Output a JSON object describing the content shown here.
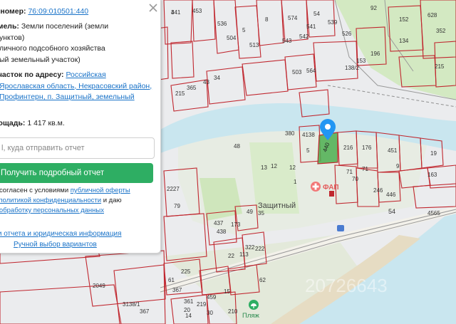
{
  "panel": {
    "cadastral_label": "й номер:",
    "cadastral_number": "76:09:010501:440",
    "category_label": "емель:",
    "category_lines": [
      "Земли поселений (земли",
      "унктов)",
      "личного подсобного хозяйства",
      "ый земельный участок)"
    ],
    "address_label": "участок по адресу:",
    "address_lines": [
      "Российская",
      "Ярославская область, Некрасовский район,",
      "Профинтерн, п. Защитный, земельный"
    ],
    "area_label": "лощадь:",
    "area_value": "1 417 кв.м.",
    "email_placeholder": "l, куда отправить отчет",
    "submit_button": "Получить подробный отчет",
    "consent_lines": [
      {
        "pre": "и согласен с условиями ",
        "link": "публичной оферты",
        "post": ""
      },
      {
        "pre": "с ",
        "link": "политикой конфиденциальности",
        "post": " и даю"
      },
      {
        "pre": "",
        "link": "а обработку персональных данных",
        "post": ""
      }
    ],
    "sample_link": "ли отчета и юридическая информация",
    "manual_link": "Ручной выбор вариантов"
  },
  "map": {
    "selected_parcel": "440",
    "place_name": "Защитный",
    "fap_label": "ФАП",
    "beach_label": "Пляж",
    "road_number": "54",
    "watermark": "20726643",
    "parcel_labels": [
      "441",
      "453",
      "536",
      "5",
      "8",
      "574",
      "54",
      "92",
      "152",
      "628",
      "352",
      "504",
      "513",
      "543",
      "542",
      "541",
      "539",
      "526",
      "215",
      "365",
      "43",
      "34",
      "503",
      "564",
      "138/2",
      "153",
      "196",
      "134",
      "215",
      "380",
      "4138",
      "48",
      "5",
      "216",
      "176",
      "12",
      "451",
      "71",
      "70",
      "71",
      "9",
      "163",
      "19",
      "13",
      "12",
      "1",
      "246",
      "446",
      "4565",
      "2227",
      "79",
      "437",
      "438",
      "49",
      "35",
      "322",
      "173",
      "222",
      "22",
      "113",
      "225",
      "2049",
      "367",
      "361",
      "3138/1",
      "367",
      "20",
      "219",
      "459",
      "15",
      "210",
      "14",
      "30",
      "61",
      "62",
      "3"
    ]
  },
  "colors": {
    "water": "#c9e6ef",
    "green": "#c8e4b4",
    "parcel": "#c0262e",
    "button": "#2eae63",
    "marker": "#2196f3"
  },
  "icons": {
    "close": "close-icon",
    "marker": "location-pin-icon",
    "fap": "medical-icon",
    "beach": "beach-icon"
  }
}
